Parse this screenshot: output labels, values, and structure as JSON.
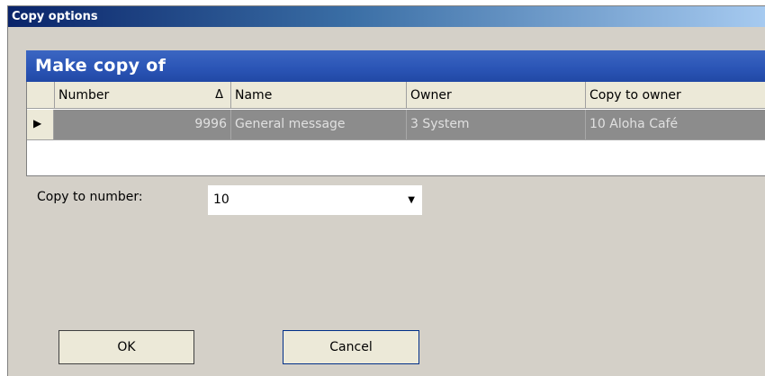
{
  "window": {
    "title": "Copy options"
  },
  "section": {
    "title": "Make copy of"
  },
  "grid": {
    "columns": [
      "Number",
      "Name",
      "Owner",
      "Copy to owner"
    ],
    "sort_indicator": "Δ",
    "rows": [
      {
        "number": "9996",
        "name": "General message",
        "owner": "3  System",
        "copy_to_owner": "10  Aloha Café"
      }
    ]
  },
  "form": {
    "copy_to_number_label": "Copy to number:",
    "copy_to_number_value": "10"
  },
  "buttons": {
    "ok": "OK",
    "cancel": "Cancel"
  }
}
